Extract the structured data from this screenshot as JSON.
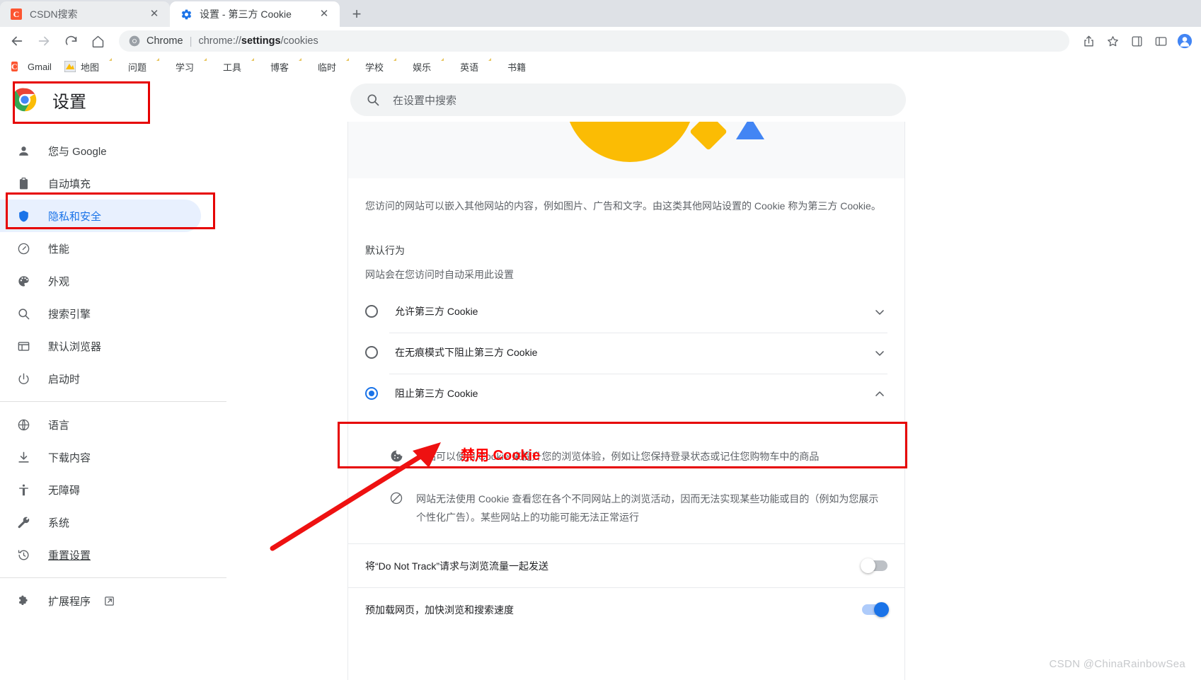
{
  "browser": {
    "tabs": [
      {
        "title": "CSDN搜索",
        "favicon": "csdn-icon",
        "active": false
      },
      {
        "title": "设置 - 第三方 Cookie",
        "favicon": "gear-icon",
        "active": true
      }
    ],
    "new_tab_label": "+",
    "close_label": "✕",
    "omnibox": {
      "chip_label": "Chrome",
      "separator": "|",
      "url_prefix": "chrome://",
      "url_bold": "settings",
      "url_suffix": "/cookies",
      "full_url": "chrome://settings/cookies"
    },
    "bookmarks": [
      {
        "label": "Gmail",
        "icon": "gmail-icon"
      },
      {
        "label": "地图",
        "icon": "maps-icon"
      },
      {
        "label": "问题",
        "icon": "folder-icon"
      },
      {
        "label": "学习",
        "icon": "folder-icon"
      },
      {
        "label": "工具",
        "icon": "folder-icon"
      },
      {
        "label": "博客",
        "icon": "folder-icon"
      },
      {
        "label": "临时",
        "icon": "folder-icon"
      },
      {
        "label": "学校",
        "icon": "folder-icon"
      },
      {
        "label": "娱乐",
        "icon": "folder-icon"
      },
      {
        "label": "英语",
        "icon": "folder-icon"
      },
      {
        "label": "书籍",
        "icon": "folder-icon"
      }
    ]
  },
  "settings": {
    "title": "设置",
    "search_placeholder": "在设置中搜索",
    "nav_groups": [
      {
        "items": [
          {
            "label": "您与 Google",
            "icon": "person-icon",
            "active": false
          },
          {
            "label": "自动填充",
            "icon": "clipboard-icon",
            "active": false
          },
          {
            "label": "隐私和安全",
            "icon": "shield-icon",
            "active": true
          },
          {
            "label": "性能",
            "icon": "speedometer-icon",
            "active": false
          },
          {
            "label": "外观",
            "icon": "palette-icon",
            "active": false
          },
          {
            "label": "搜索引擎",
            "icon": "search-icon",
            "active": false
          },
          {
            "label": "默认浏览器",
            "icon": "browser-window-icon",
            "active": false
          },
          {
            "label": "启动时",
            "icon": "power-icon",
            "active": false
          }
        ]
      },
      {
        "items": [
          {
            "label": "语言",
            "icon": "globe-icon",
            "active": false
          },
          {
            "label": "下载内容",
            "icon": "download-icon",
            "active": false
          },
          {
            "label": "无障碍",
            "icon": "accessibility-icon",
            "active": false
          },
          {
            "label": "系统",
            "icon": "wrench-icon",
            "active": false
          },
          {
            "label": "重置设置",
            "icon": "history-icon",
            "active": false,
            "underlined": true
          }
        ]
      },
      {
        "items": [
          {
            "label": "扩展程序",
            "icon": "puzzle-icon",
            "active": false,
            "external": true,
            "external_icon": "external-link-icon"
          }
        ]
      }
    ]
  },
  "content": {
    "description": "您访问的网站可以嵌入其他网站的内容，例如图片、广告和文字。由这类其他网站设置的 Cookie 称为第三方 Cookie。",
    "default_behavior_title": "默认行为",
    "default_behavior_sub": "网站会在您访问时自动采用此设置",
    "radio_options": [
      {
        "label": "允许第三方 Cookie",
        "checked": false,
        "expand_icon": "chevron-down-icon"
      },
      {
        "label": "在无痕模式下阻止第三方 Cookie",
        "checked": false,
        "expand_icon": "chevron-down-icon"
      },
      {
        "label": "阻止第三方 Cookie",
        "checked": true,
        "expand_icon": "chevron-up-icon"
      }
    ],
    "bullets": [
      {
        "icon": "cookie-icon",
        "text": "网站可以使用 Cookie 来提升您的浏览体验，例如让您保持登录状态或记住您购物车中的商品"
      },
      {
        "icon": "block-icon",
        "text": "网站无法使用 Cookie 查看您在各个不同网站上的浏览活动，因而无法实现某些功能或目的（例如为您展示个性化广告）。某些网站上的功能可能无法正常运行"
      }
    ],
    "toggles": [
      {
        "label": "将“Do Not Track”请求与浏览流量一起发送",
        "on": false
      },
      {
        "label": "预加载网页，加快浏览和搜索速度",
        "on": true
      }
    ]
  },
  "annotations": {
    "callout_text": "禁用 Cookie",
    "callout_color": "#ff0000",
    "box_color": "#e60000",
    "boxes": [
      "settings-title-box",
      "privacy-nav-box",
      "block-cookies-box"
    ],
    "arrow": "red-arrow-pointing-to-block-cookies"
  },
  "watermark": {
    "text": "CSDN @ChinaRainbowSea"
  }
}
